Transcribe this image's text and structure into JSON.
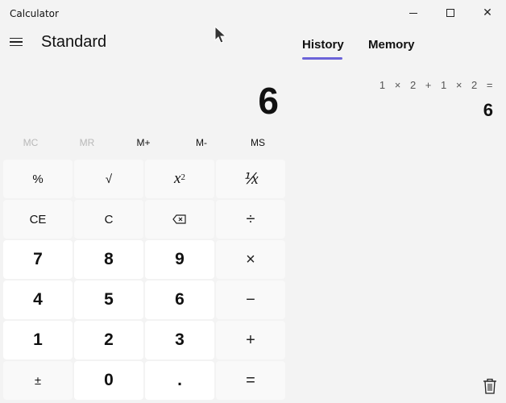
{
  "window": {
    "title": "Calculator",
    "min_icon": "minimize-icon",
    "max_icon": "maximize-icon",
    "close_symbol": "✕"
  },
  "header": {
    "mode": "Standard",
    "menu_icon": "hamburger-icon"
  },
  "tabs": [
    {
      "label": "History",
      "active": true
    },
    {
      "label": "Memory",
      "active": false
    }
  ],
  "accent_color": "#6b63d8",
  "display": {
    "value": "6"
  },
  "memory": [
    {
      "label": "MC",
      "enabled": false
    },
    {
      "label": "MR",
      "enabled": false
    },
    {
      "label": "M+",
      "enabled": true
    },
    {
      "label": "M-",
      "enabled": true
    },
    {
      "label": "MS",
      "enabled": true
    }
  ],
  "keys": {
    "percent": "%",
    "sqrt": "√",
    "square_base": "x",
    "square_exp": "2",
    "reciprocal": "⅟x",
    "ce": "CE",
    "c": "C",
    "backspace_icon": "backspace-icon",
    "divide": "÷",
    "seven": "7",
    "eight": "8",
    "nine": "9",
    "multiply": "×",
    "four": "4",
    "five": "5",
    "six": "6",
    "minus": "−",
    "one": "1",
    "two": "2",
    "three": "3",
    "plus": "+",
    "negate": "±",
    "zero": "0",
    "decimal": ".",
    "equals": "="
  },
  "history": {
    "expression": "1 × 2 + 1 × 2 =",
    "result": "6",
    "clear_icon": "trash-icon"
  }
}
